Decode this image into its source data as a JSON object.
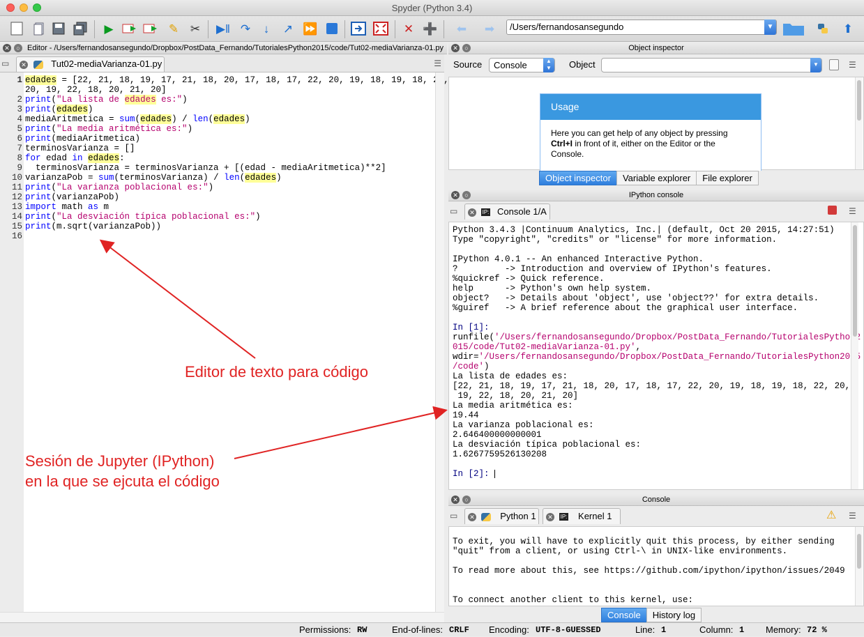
{
  "window": {
    "title": "Spyder (Python 3.4)"
  },
  "toolbar": {
    "path": "/Users/fernandosansegundo"
  },
  "editor": {
    "pane_title": "Editor - /Users/fernandosansegundo/Dropbox/PostData_Fernando/TutorialesPython2015/code/Tut02-mediaVarianza-01.py",
    "tab_label": "Tut02-mediaVarianza-01.py",
    "line_numbers": [
      "1",
      "",
      "2",
      "3",
      "4",
      "5",
      "6",
      "7",
      "8",
      "9",
      "10",
      "11",
      "12",
      "13",
      "14",
      "15",
      "16"
    ]
  },
  "annotations": {
    "editor_label": "Editor de texto para código",
    "console_label_1": "Sesión de Jupyter (IPython)",
    "console_label_2": "en la que se ejcuta el código"
  },
  "inspector": {
    "pane_title": "Object inspector",
    "source_label": "Source",
    "source_value": "Console",
    "object_label": "Object",
    "usage_title": "Usage",
    "usage_text_1": "Here you can get help of any object by pressing",
    "usage_text_bold": "Ctrl+I",
    "usage_text_2": " in front of it, either on the Editor or the",
    "usage_text_3": "Console.",
    "tabs": [
      "Object inspector",
      "Variable explorer",
      "File explorer"
    ]
  },
  "ipython": {
    "pane_title": "IPython console",
    "tab_label": "Console 1/A",
    "banner": [
      "Python 3.4.3 |Continuum Analytics, Inc.| (default, Oct 20 2015, 14:27:51)",
      "Type \"copyright\", \"credits\" or \"license\" for more information.",
      "",
      "IPython 4.0.1 -- An enhanced Interactive Python.",
      "?         -> Introduction and overview of IPython's features.",
      "%quickref -> Quick reference.",
      "help      -> Python's own help system.",
      "object?   -> Details about 'object', use 'object??' for extra details.",
      "%guiref   -> A brief reference about the graphical user interface."
    ],
    "prompt1": "In [1]:",
    "runfile_1": "runfile(",
    "runfile_2": "'/Users/fernandosansegundo/Dropbox/PostData_Fernando/TutorialesPython2",
    "runfile_3": "015/code/Tut02-mediaVarianza-01.py'",
    "runfile_4": ",",
    "wdir_1": "wdir=",
    "wdir_2": "'/Users/fernandosansegundo/Dropbox/PostData_Fernando/TutorialesPython2015",
    "wdir_3": "/code'",
    "wdir_4": ")",
    "output": [
      "La lista de edades es:",
      "[22, 21, 18, 19, 17, 21, 18, 20, 17, 18, 17, 22, 20, 19, 18, 19, 18, 22, 20,",
      " 19, 22, 18, 20, 21, 20]",
      "La media aritmética es:",
      "19.44",
      "La varianza poblacional es:",
      "2.646400000000001",
      "La desviación típica poblacional es:",
      "1.6267759526130208"
    ],
    "prompt2": "In [2]:"
  },
  "console": {
    "pane_title": "Console",
    "tab1": "Python 1",
    "tab2": "Kernel 1",
    "lines": [
      "To exit, you will have to explicitly quit this process, by either sending",
      "\"quit\" from a client, or using Ctrl-\\ in UNIX-like environments.",
      "",
      "To read more about this, see https://github.com/ipython/ipython/issues/2049",
      "",
      "",
      "To connect another client to this kernel, use:"
    ],
    "bottom_tabs": [
      "Console",
      "History log"
    ]
  },
  "status": {
    "permissions_label": "Permissions:",
    "permissions": "RW",
    "eol_label": "End-of-lines:",
    "eol": "CRLF",
    "encoding_label": "Encoding:",
    "encoding": "UTF-8-GUESSED",
    "line_label": "Line:",
    "line": "1",
    "column_label": "Column:",
    "column": "1",
    "memory_label": "Memory:",
    "memory": "72 %"
  }
}
